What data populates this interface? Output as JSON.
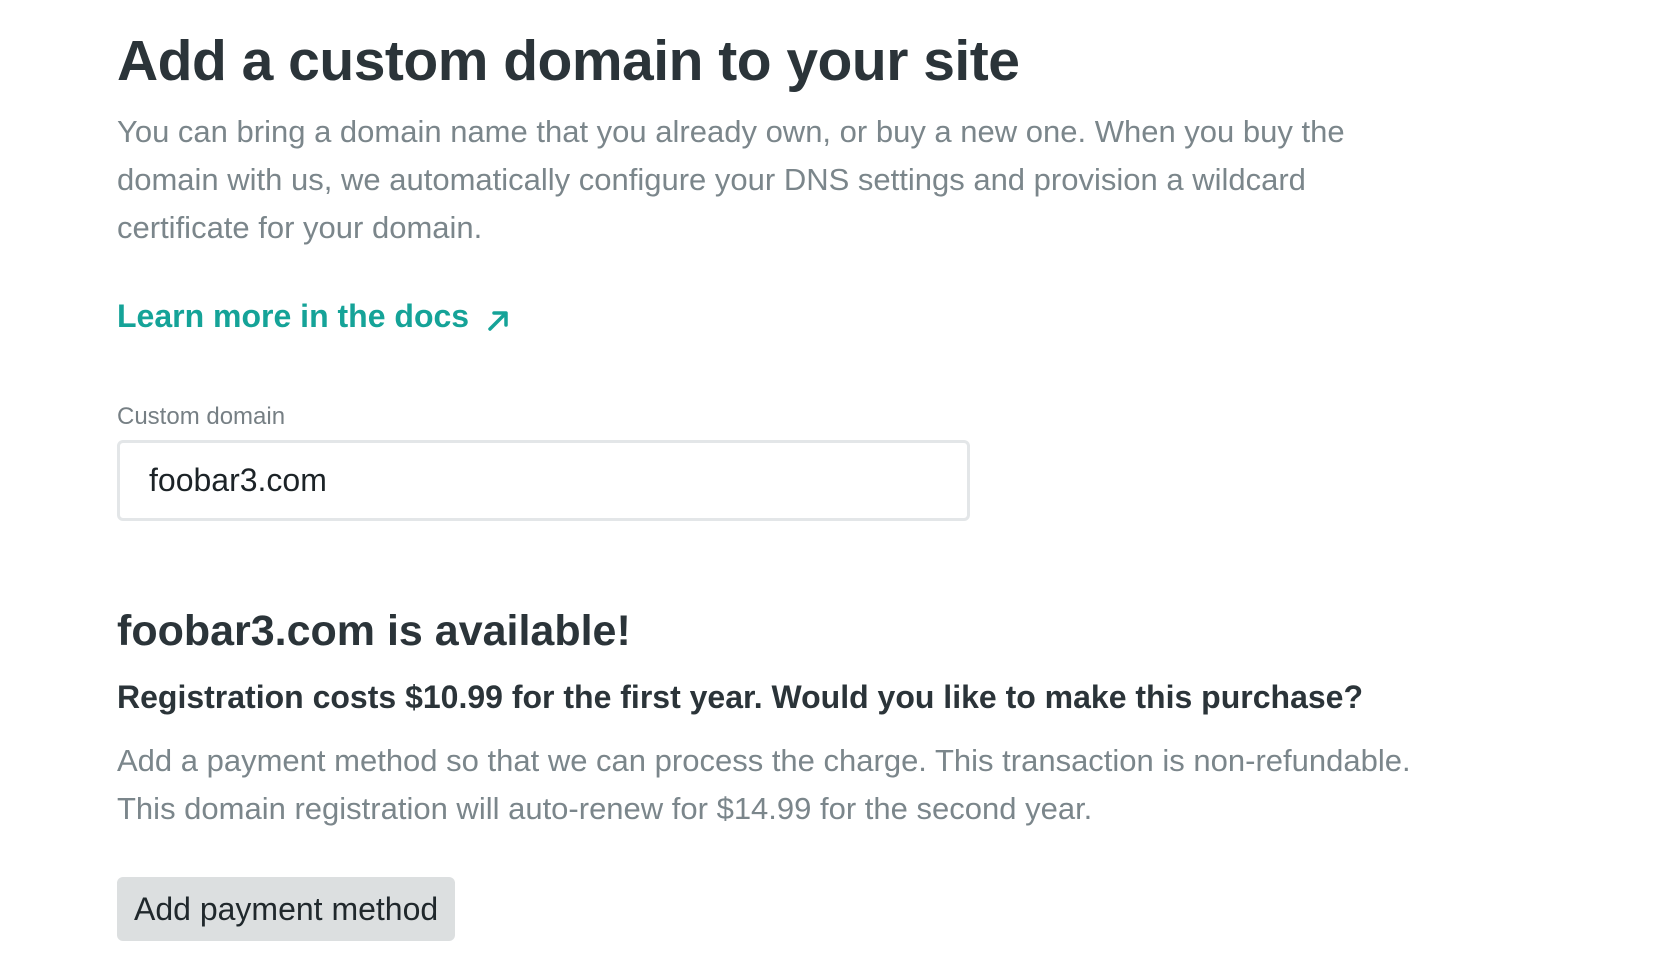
{
  "page": {
    "title": "Add a custom domain to your site",
    "intro": "You can bring a domain name that you already own, or buy a new one. When you buy the domain with us, we automatically configure your DNS settings and provision a wildcard certificate for your domain.",
    "docs_link": "Learn more in the docs",
    "docs_link_icon": "external-arrow-icon"
  },
  "form": {
    "label": "Custom domain",
    "value": "foobar3.com"
  },
  "availability": {
    "title": "foobar3.com is available!",
    "cost_line": "Registration costs $10.99 for the first year. Would you like to make this purchase?",
    "info": "Add a payment method so that we can process the charge. This transaction is non-refundable. This domain registration will auto-renew for $14.99 for the second year.",
    "button_label": "Add payment method"
  },
  "colors": {
    "accent": "#15a398",
    "heading": "#2b3439",
    "muted_text": "#7b868b",
    "button_bg": "#dcdfe0"
  }
}
